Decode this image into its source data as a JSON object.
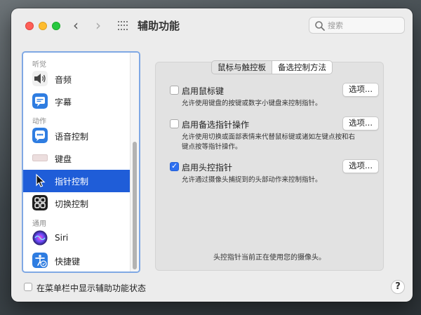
{
  "window": {
    "title": "辅助功能"
  },
  "search": {
    "placeholder": "搜索",
    "value": ""
  },
  "sidebar": {
    "sections": [
      {
        "label": "听觉"
      },
      {
        "label": "动作"
      },
      {
        "label": "通用"
      }
    ],
    "items": [
      {
        "label": "音频",
        "icon": "speaker-icon"
      },
      {
        "label": "字幕",
        "icon": "captions-icon"
      },
      {
        "label": "语音控制",
        "icon": "voice-control-icon"
      },
      {
        "label": "键盘",
        "icon": "keyboard-icon"
      },
      {
        "label": "指针控制",
        "icon": "pointer-icon",
        "selected": true
      },
      {
        "label": "切换控制",
        "icon": "switch-control-icon"
      },
      {
        "label": "Siri",
        "icon": "siri-icon"
      },
      {
        "label": "快捷键",
        "icon": "shortcut-icon"
      }
    ]
  },
  "tabs": [
    {
      "label": "鼠标与触控板",
      "active": false
    },
    {
      "label": "备选控制方法",
      "active": true
    }
  ],
  "options": [
    {
      "label": "启用鼠标键",
      "checked": false,
      "description": "允许使用键盘的按键或数字小键盘来控制指针。",
      "button": "选项..."
    },
    {
      "label": "启用备选指针操作",
      "checked": false,
      "description": "允许使用切换或面部表情来代替鼠标键或诸如左键点按和右键点按等指针操作。",
      "button": "选项..."
    },
    {
      "label": "启用头控指针",
      "checked": true,
      "description": "允许通过摄像头捕捉到的头部动作来控制指针。",
      "button": "选项..."
    }
  ],
  "footnote": "头控指针当前正在使用您的摄像头。",
  "bottom": {
    "menu_bar_label": "在菜单栏中显示辅助功能状态",
    "menu_bar_checked": false,
    "help": "?"
  },
  "colors": {
    "accent": "#1f5dd8",
    "checkbox_checked": "#2d6ff0",
    "focus_ring": "#7fa8e4"
  }
}
